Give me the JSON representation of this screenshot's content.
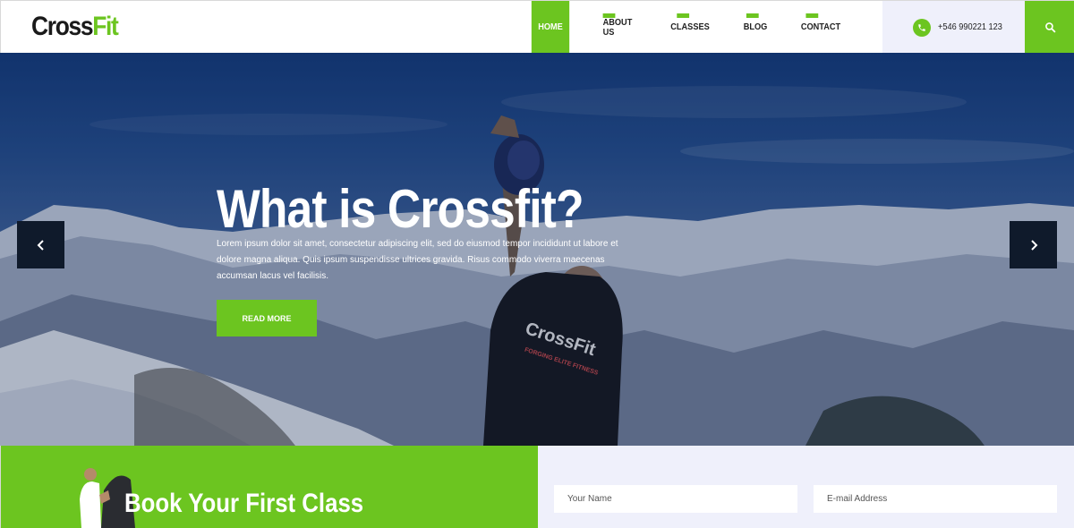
{
  "header": {
    "logo_part1": "Cross",
    "logo_part2": "Fit",
    "nav": [
      {
        "label": "HOME",
        "active": true
      },
      {
        "label": "ABOUT US",
        "active": false
      },
      {
        "label": "CLASSES",
        "active": false
      },
      {
        "label": "BLOG",
        "active": false
      },
      {
        "label": "CONTACT",
        "active": false
      }
    ],
    "phone": "+546 990221 123",
    "phone_icon": "phone-icon",
    "search_icon": "search-icon"
  },
  "hero": {
    "title": "What is Crossfit?",
    "text": "Lorem ipsum dolor sit amet, consectetur adipiscing elit, sed do eiusmod tempor incididunt ut labore et dolore magna aliqua. Quis ipsum suspendisse ultrices gravida. Risus commodo viverra maecenas accumsan lacus vel facilisis.",
    "button": "READ MORE",
    "shirt_text": "CrossFit",
    "shirt_sub": "FORGING ELITE FITNESS",
    "prev_icon": "chevron-left-icon",
    "next_icon": "chevron-right-icon"
  },
  "booking": {
    "title": "Book Your First Class",
    "name_placeholder": "Your Name",
    "email_placeholder": "E-mail Address"
  },
  "colors": {
    "accent": "#6cc520",
    "dark": "#0f1a2b",
    "light_panel": "#eff0fb"
  }
}
